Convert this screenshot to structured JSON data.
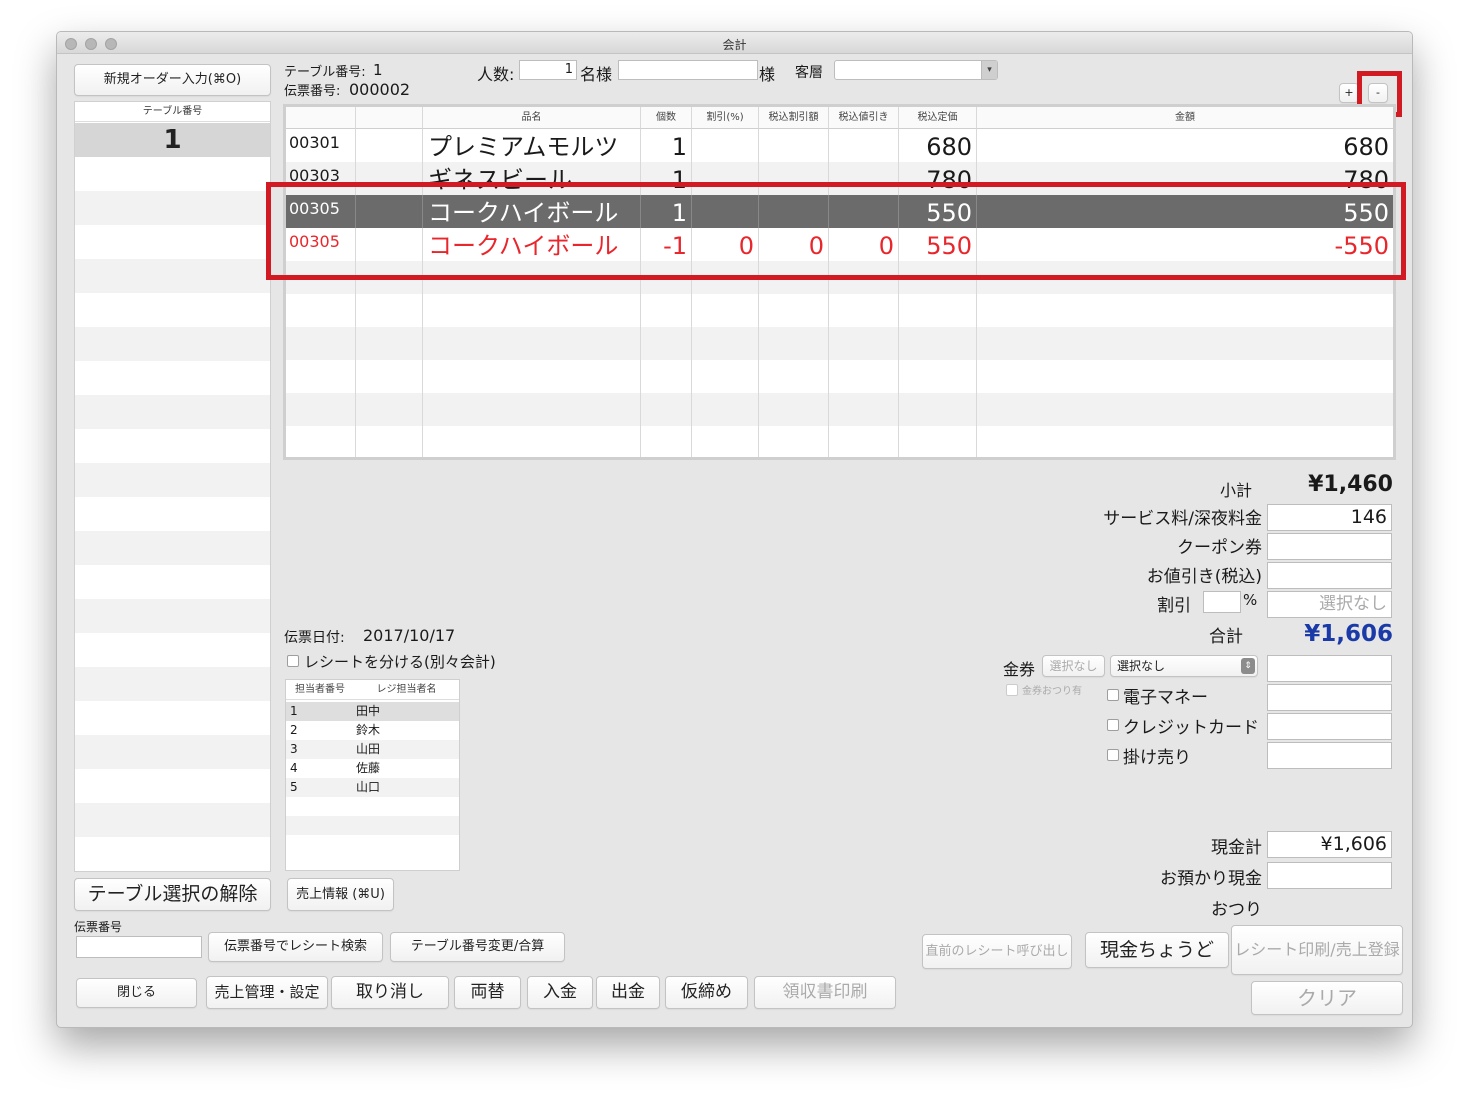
{
  "window": {
    "title": "会計"
  },
  "toolbar": {
    "new_order_button": "新規オーダー入力(⌘O)"
  },
  "table_list": {
    "header": "テーブル番号",
    "selected": "1"
  },
  "header": {
    "table_no_label": "テーブル番号:",
    "table_no": "1",
    "slip_no_label": "伝票番号:",
    "slip_no": "000002",
    "guests_label": "人数:",
    "guests": "1",
    "name_label": "名様",
    "customer_name": "",
    "sama": "様",
    "segment_label": "客層",
    "segment_value": "",
    "plus_button": "+",
    "minus_button": "-"
  },
  "order_grid": {
    "columns": [
      "",
      "",
      "品名",
      "個数",
      "割引(%)",
      "税込割引額",
      "税込値引き",
      "税込定価",
      "金額"
    ],
    "rows": [
      {
        "code": "00301",
        "name": "プレミアムモルツ",
        "qty": "1",
        "disc_pct": "",
        "disc_amt": "",
        "nebiki": "",
        "price": "680",
        "amount": "680"
      },
      {
        "code": "00303",
        "name": "ギネスビール",
        "qty": "1",
        "disc_pct": "",
        "disc_amt": "",
        "nebiki": "",
        "price": "780",
        "amount": "780"
      },
      {
        "code": "00305",
        "name": "コークハイボール",
        "qty": "1",
        "disc_pct": "",
        "disc_amt": "",
        "nebiki": "",
        "price": "550",
        "amount": "550"
      },
      {
        "code": "00305",
        "name": "コークハイボール",
        "qty": "-1",
        "disc_pct": "0",
        "disc_amt": "0",
        "nebiki": "0",
        "price": "550",
        "amount": "-550"
      }
    ]
  },
  "slip": {
    "date_label": "伝票日付:",
    "date": "2017/10/17",
    "split_receipt_label": "レシートを分ける(別々会計)"
  },
  "staff_table": {
    "columns": [
      "担当者番号",
      "レジ担当者名"
    ],
    "rows": [
      {
        "no": "1",
        "name": "田中"
      },
      {
        "no": "2",
        "name": "鈴木"
      },
      {
        "no": "3",
        "name": "山田"
      },
      {
        "no": "4",
        "name": "佐藤"
      },
      {
        "no": "5",
        "name": "山口"
      }
    ]
  },
  "totals": {
    "subtotal_label": "小計",
    "subtotal": "¥1,460",
    "service_label": "サービス料/深夜料金",
    "service": "146",
    "coupon_label": "クーポン券",
    "coupon": "",
    "nebiki_label": "お値引き(税込)",
    "nebiki": "",
    "discount_label": "割引",
    "discount_pct": "",
    "pct_sign": "%",
    "discount_select": "選択なし",
    "total_label": "合計",
    "total": "¥1,606",
    "voucher_label": "金券",
    "voucher_select_1": "選択なし",
    "voucher_select_2": "選択なし",
    "voucher_change_label": "金券おつり有",
    "emoney_label": "電子マネー",
    "credit_label": "クレジットカード",
    "kakeuri_label": "掛け売り",
    "cash_total_label": "現金計",
    "cash_total": "¥1,606",
    "deposit_label": "お預かり現金",
    "deposit": "",
    "change_label": "おつり",
    "change": ""
  },
  "buttons": {
    "release_table": "テーブル選択の解除",
    "sales_info": "売上情報 (⌘U)",
    "slip_no_label": "伝票番号",
    "slip_no_value": "",
    "receipt_search": "伝票番号でレシート検索",
    "table_change": "テーブル番号変更/合算",
    "close": "閉じる",
    "sales_manage": "売上管理・設定",
    "cancel": "取り消し",
    "exchange": "両替",
    "deposit_in": "入金",
    "withdraw": "出金",
    "temp_close": "仮締め",
    "receipt_print": "領収書印刷",
    "prev_receipt": "直前のレシート呼び出し",
    "exact_cash": "現金ちょうど",
    "print_register": "レシート印刷/売上登録",
    "clear": "クリア"
  },
  "colors": {
    "highlight_red": "#d11a21",
    "total_blue": "#1a3aa8",
    "negative_red": "#e8262b",
    "selected_row": "#6b6b6b"
  }
}
